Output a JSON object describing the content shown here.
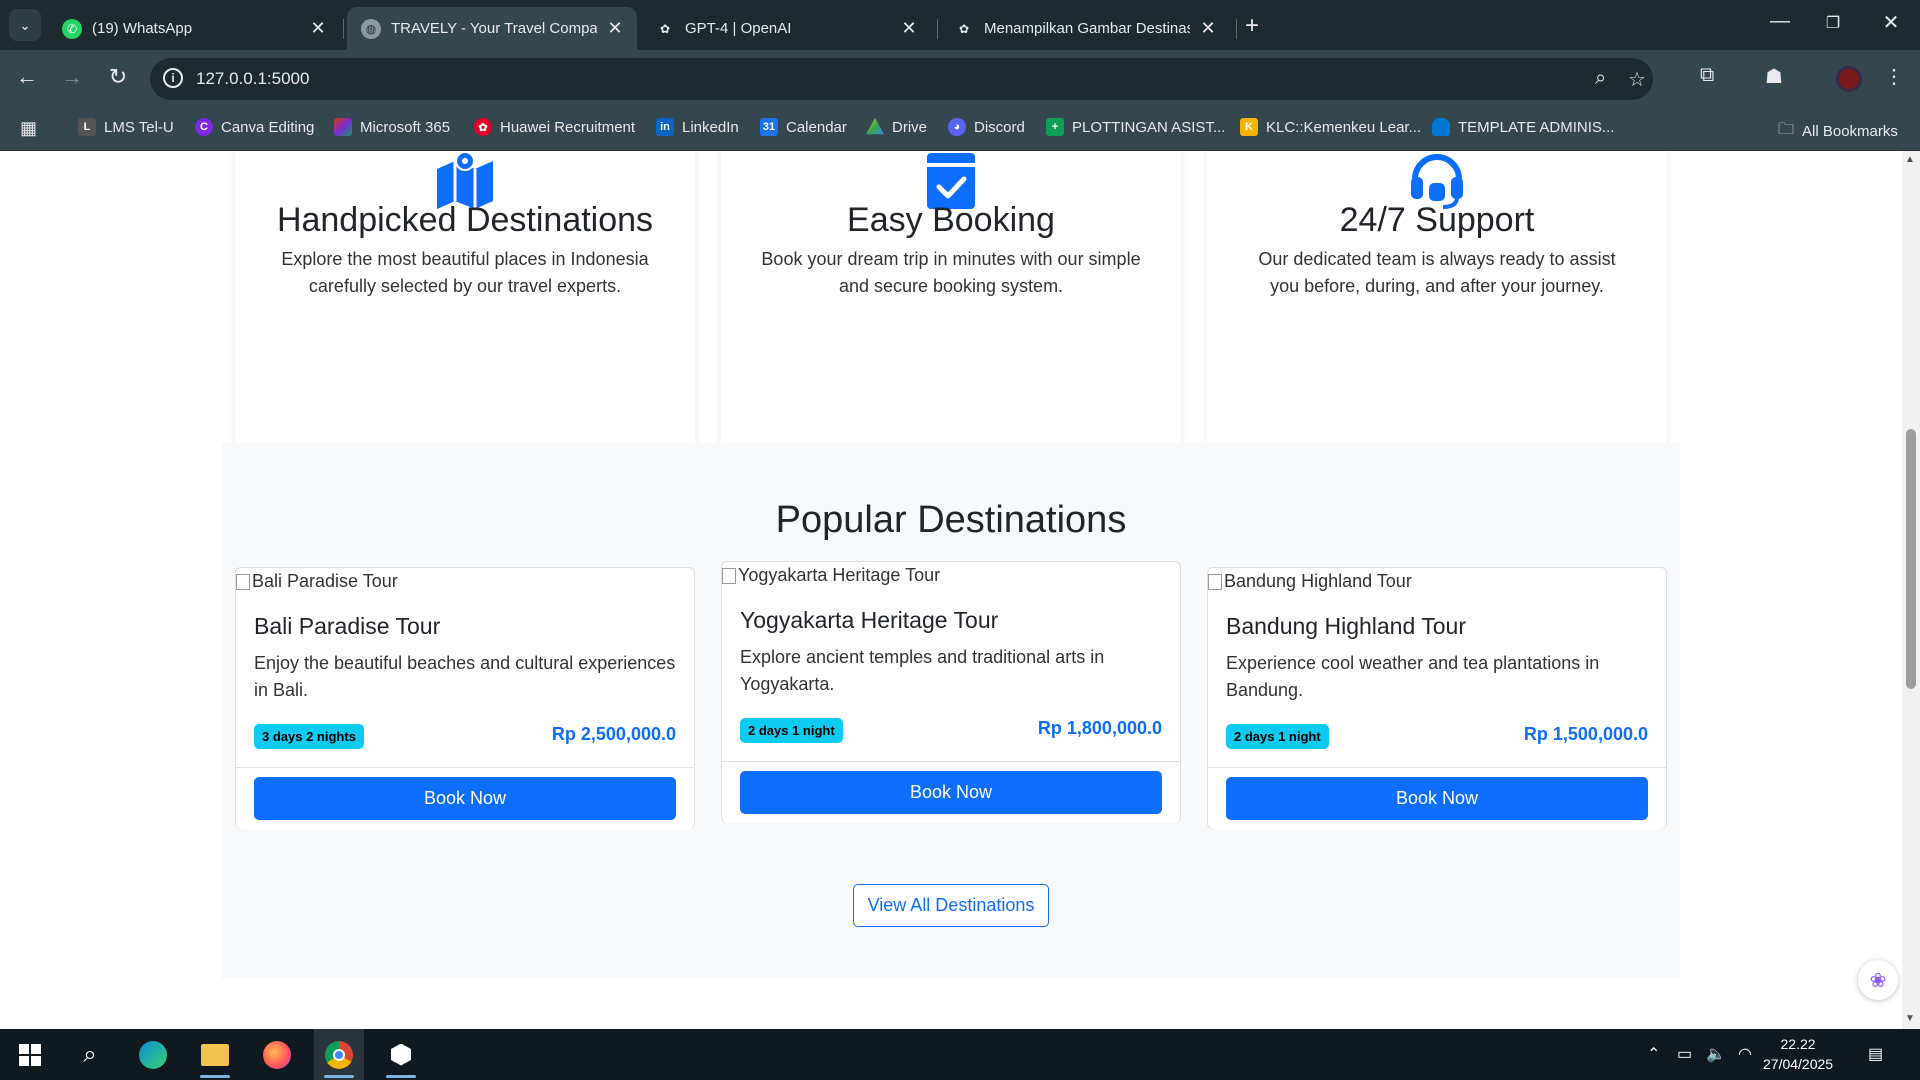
{
  "browser": {
    "tabs": [
      {
        "title": "(19) WhatsApp",
        "icon": "whatsapp-icon"
      },
      {
        "title": "TRAVELY - Your Travel Companion",
        "icon": "globe-icon"
      },
      {
        "title": "GPT-4 | OpenAI",
        "icon": "openai-icon"
      },
      {
        "title": "Menampilkan Gambar Destinasi",
        "icon": "openai-icon"
      }
    ],
    "url": "127.0.0.1:5000",
    "bookmarks": [
      {
        "label": "LMS Tel-U",
        "color": "#555555"
      },
      {
        "label": "Canva Editing",
        "color": "#7d2ae8"
      },
      {
        "label": "Microsoft 365",
        "color": "#d83b01"
      },
      {
        "label": "Huawei Recruitment",
        "color": "#e4002b"
      },
      {
        "label": "LinkedIn",
        "color": "#0a66c2"
      },
      {
        "label": "Calendar",
        "color": "#1a73e8"
      },
      {
        "label": "Drive",
        "color": "#34a853"
      },
      {
        "label": "Discord",
        "color": "#e53935"
      },
      {
        "label": "PLOTTINGAN ASIST...",
        "color": "#0f9d58"
      },
      {
        "label": "KLC::Kemenkeu Lear...",
        "color": "#f4b400"
      },
      {
        "label": "TEMPLATE ADMINIS...",
        "color": "#0078d4"
      }
    ],
    "all_bookmarks": "All Bookmarks"
  },
  "features": [
    {
      "title": "Handpicked Destinations",
      "text": "Explore the most beautiful places in Indonesia carefully selected by our travel experts.",
      "icon": "map-icon"
    },
    {
      "title": "Easy Booking",
      "text": "Book your dream trip in minutes with our simple and secure booking system.",
      "icon": "calendar-check-icon"
    },
    {
      "title": "24/7 Support",
      "text": "Our dedicated team is always ready to assist you before, during, and after your journey.",
      "icon": "headset-icon"
    }
  ],
  "popular": {
    "heading": "Popular Destinations",
    "view_all": "View All Destinations",
    "cards": [
      {
        "img_alt": "Bali Paradise Tour",
        "title": "Bali Paradise Tour",
        "desc": "Enjoy the beautiful beaches and cultural experiences in Bali.",
        "duration": "3 days 2 nights",
        "price": "Rp 2,500,000.0",
        "button": "Book Now"
      },
      {
        "img_alt": "Yogyakarta Heritage Tour",
        "title": "Yogyakarta Heritage Tour",
        "desc": "Explore ancient temples and traditional arts in Yogyakarta.",
        "duration": "2 days 1 night",
        "price": "Rp 1,800,000.0",
        "button": "Book Now"
      },
      {
        "img_alt": "Bandung Highland Tour",
        "title": "Bandung Highland Tour",
        "desc": "Experience cool weather and tea plantations in Bandung.",
        "duration": "2 days 1 night",
        "price": "Rp 1,500,000.0",
        "button": "Book Now"
      }
    ]
  },
  "taskbar": {
    "time": "22.22",
    "date": "27/04/2025"
  },
  "colors": {
    "primary": "#0d6efd",
    "badge": "#0dcaf0",
    "section_bg": "#f8f9fa"
  }
}
